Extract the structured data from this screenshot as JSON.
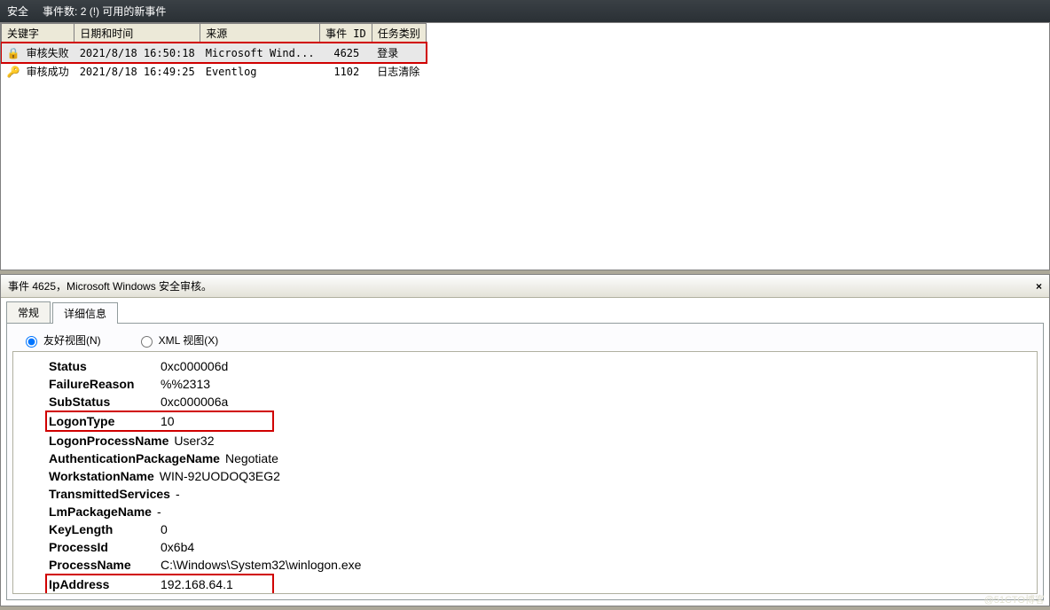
{
  "titlebar": {
    "section": "安全",
    "count_label": "事件数:",
    "count_value": "2 (!)",
    "suffix": "可用的新事件"
  },
  "event_table": {
    "headers": {
      "keyword": "关键字",
      "datetime": "日期和时间",
      "source": "来源",
      "event_id": "事件 ID",
      "task_category": "任务类别"
    },
    "rows": [
      {
        "keyword": "审核失败",
        "datetime": "2021/8/18 16:50:18",
        "source": "Microsoft Wind...",
        "event_id": "4625",
        "task_category": "登录",
        "selected": true,
        "icon": "🔒",
        "highlight": true
      },
      {
        "keyword": "审核成功",
        "datetime": "2021/8/18 16:49:25",
        "source": "Eventlog",
        "event_id": "1102",
        "task_category": "日志清除",
        "selected": false,
        "icon": "🔑",
        "highlight": false
      }
    ]
  },
  "detail": {
    "title": "事件 4625，Microsoft Windows 安全审核。",
    "close": "×",
    "tabs": {
      "general": "常规",
      "details": "详细信息"
    },
    "view": {
      "friendly": "友好视图(N)",
      "xml": "XML 视图(X)"
    },
    "fields": [
      {
        "k": "Status",
        "v": "0xc000006d",
        "highlight": false
      },
      {
        "k": "FailureReason",
        "v": "%%2313",
        "highlight": false
      },
      {
        "k": "SubStatus",
        "v": "0xc000006a",
        "highlight": false
      },
      {
        "k": "LogonType",
        "v": "10",
        "highlight": true
      },
      {
        "k": "LogonProcessName",
        "v": "User32",
        "tight": true
      },
      {
        "k": "AuthenticationPackageName",
        "v": "Negotiate",
        "tight": true
      },
      {
        "k": "WorkstationName",
        "v": "WIN-92UODOQ3EG2",
        "tight": true
      },
      {
        "k": "TransmittedServices",
        "v": "-",
        "tight": true
      },
      {
        "k": "LmPackageName",
        "v": "-",
        "tight": true
      },
      {
        "k": "KeyLength",
        "v": "0"
      },
      {
        "k": "ProcessId",
        "v": "0x6b4"
      },
      {
        "k": "ProcessName",
        "v": "C:\\Windows\\System32\\winlogon.exe"
      },
      {
        "k": "IpAddress",
        "v": "192.168.64.1",
        "highlight": true
      }
    ]
  },
  "watermark": "@51CTO博客"
}
